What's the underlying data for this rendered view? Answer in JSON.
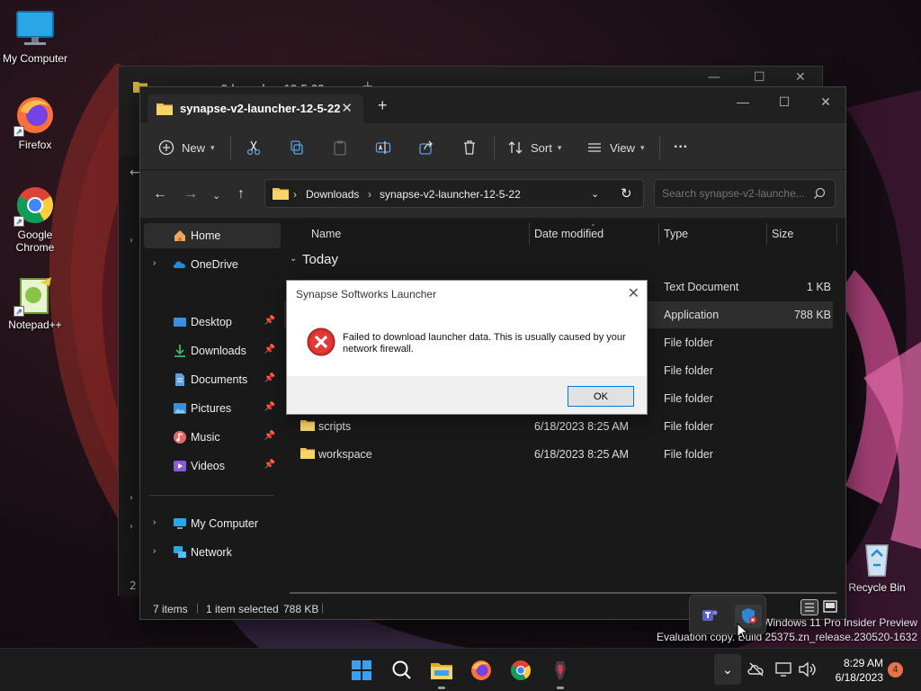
{
  "desktop": {
    "icons": [
      {
        "label": "My Computer"
      },
      {
        "label": "Firefox"
      },
      {
        "label": "Google Chrome"
      },
      {
        "label": "Notepad++"
      },
      {
        "label": "Recycle Bin"
      }
    ],
    "watermark": {
      "line1": "Windows 11 Pro Insider Preview",
      "line2": "Evaluation copy. Build 25375.zn_release.230520-1632"
    }
  },
  "back_window": {
    "tab_title": "synapse-v2-launcher-12-5-22",
    "status_partial": "2 i"
  },
  "window": {
    "tab_title": "synapse-v2-launcher-12-5-22",
    "toolbar": {
      "new_label": "New",
      "sort_label": "Sort",
      "view_label": "View",
      "more_label": "···"
    },
    "address": {
      "crumbs": [
        "Downloads",
        "synapse-v2-launcher-12-5-22"
      ]
    },
    "search": {
      "placeholder": "Search synapse-v2-launche..."
    },
    "nav": {
      "home": "Home",
      "onedrive": "OneDrive",
      "quick": [
        "Desktop",
        "Downloads",
        "Documents",
        "Pictures",
        "Music",
        "Videos"
      ],
      "my_computer": "My Computer",
      "network": "Network"
    },
    "columns": {
      "name": "Name",
      "date": "Date modified",
      "type": "Type",
      "size": "Size"
    },
    "group": "Today",
    "rows": [
      {
        "name": "",
        "date": "",
        "type": "Text Document",
        "size": "1 KB"
      },
      {
        "name": "",
        "date": "",
        "type": "Application",
        "size": "788 KB"
      },
      {
        "name": "",
        "date": "",
        "type": "File folder",
        "size": ""
      },
      {
        "name": "",
        "date": "",
        "type": "File folder",
        "size": ""
      },
      {
        "name": "",
        "date": "",
        "type": "File folder",
        "size": ""
      },
      {
        "name": "scripts",
        "date": "6/18/2023 8:25 AM",
        "type": "File folder",
        "size": ""
      },
      {
        "name": "workspace",
        "date": "6/18/2023 8:25 AM",
        "type": "File folder",
        "size": ""
      }
    ],
    "status": {
      "items": "7 items",
      "selected": "1 item selected",
      "size": "788 KB"
    }
  },
  "dialog": {
    "title": "Synapse Softworks Launcher",
    "message": "Failed to download launcher data. This is usually caused by your network firewall.",
    "ok_label": "OK"
  },
  "taskbar": {
    "time": "8:29 AM",
    "date": "6/18/2023",
    "notification_count": "4"
  },
  "colors": {
    "accent": "#0078d4",
    "error": "#d32f2f",
    "folder": "#f3c44a"
  }
}
